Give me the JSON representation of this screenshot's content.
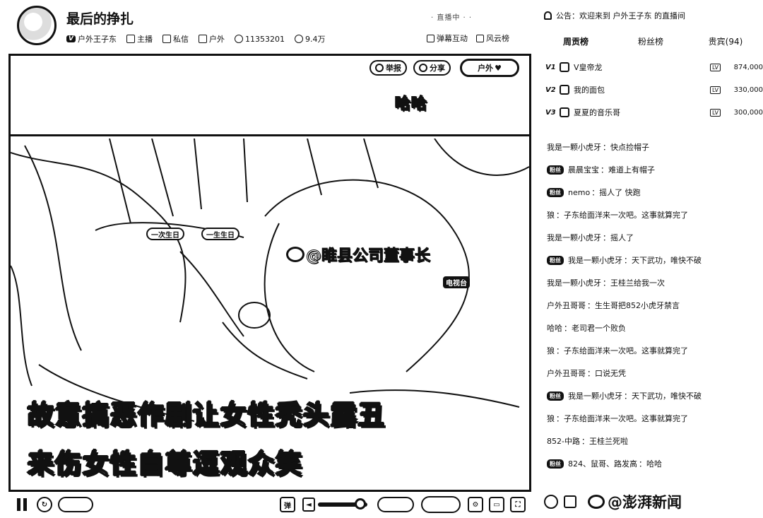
{
  "header": {
    "title": "最后的挣扎",
    "meta_right": "· 直播中   ·   · ",
    "anchor_badge": "V",
    "anchor_name": "户外王子东",
    "items": [
      "主播",
      "私信",
      "户外"
    ],
    "room_id": "11353201",
    "viewers": "9.4万",
    "right_items": [
      "弹幕互动",
      "风云榜"
    ]
  },
  "player": {
    "buttons": {
      "follow": "举报",
      "share": "分享",
      "category": "户外"
    },
    "haha": "哈哈",
    "name_tags": [
      "一次生日",
      "一生生日"
    ],
    "watermark": "@睢县公司董事长",
    "tv_badge": "电视台",
    "subtitle_line1": "故意搞恶作剧让女性秃头露丑",
    "subtitle_line2": "来伤女性自尊逗观众笑"
  },
  "controls": {
    "time": "",
    "quality": "",
    "speed": "",
    "volume_level": 0.85
  },
  "panel": {
    "announcement": "公告：欢迎来到 户外王子东 的直播间",
    "tabs": [
      "周贡榜",
      "粉丝榜",
      "贵宾(94)"
    ],
    "ranking": [
      {
        "medal": "V1",
        "name": "V皇帝龙",
        "level": "LV",
        "score": "874,000"
      },
      {
        "medal": "V2",
        "name": "我的面包",
        "level": "LV",
        "score": "330,000"
      },
      {
        "medal": "V3",
        "name": "夏夏的音乐哥",
        "level": "LV",
        "score": "300,000"
      }
    ],
    "chat": [
      {
        "badge": "",
        "user": "我是一颗小虎牙",
        "text": "：快点捡帽子"
      },
      {
        "badge": "粉丝",
        "user": "晨晨宝宝",
        "text": "：难道上有帽子"
      },
      {
        "badge": "粉丝",
        "user": "nemo",
        "text": "：摇人了 快跑"
      },
      {
        "badge": "",
        "user": "狼",
        "text": "：子东给面洋来一次吧。这事就算完了"
      },
      {
        "badge": "",
        "user": "我是一颗小虎牙",
        "text": "：摇人了"
      },
      {
        "badge": "粉丝",
        "user": "我是一颗小虎牙",
        "text": "：天下武功，唯快不破"
      },
      {
        "badge": "",
        "user": "我是一颗小虎牙",
        "text": "：王桂兰给我一次"
      },
      {
        "badge": "",
        "user": "户外丑哥哥",
        "text": "：生生哥把852小虎牙禁言"
      },
      {
        "badge": "",
        "user": "哈哈",
        "text": "：老司君一个败负"
      },
      {
        "badge": "",
        "user": "狼",
        "text": "：子东给面洋来一次吧。这事就算完了"
      },
      {
        "badge": "",
        "user": "户外丑哥哥",
        "text": "：口说无凭"
      },
      {
        "badge": "粉丝",
        "user": "我是一颗小虎牙",
        "text": "：天下武功，唯快不破"
      },
      {
        "badge": "",
        "user": "狼",
        "text": "：子东给面洋来一次吧。这事就算完了"
      },
      {
        "badge": "",
        "user": "852-中路",
        "text": "：王桂兰死啦"
      },
      {
        "badge": "粉丝",
        "user": "824、鼠哥、路发高",
        "text": "：哈哈"
      }
    ],
    "footer_watermark": "@澎湃新闻"
  }
}
